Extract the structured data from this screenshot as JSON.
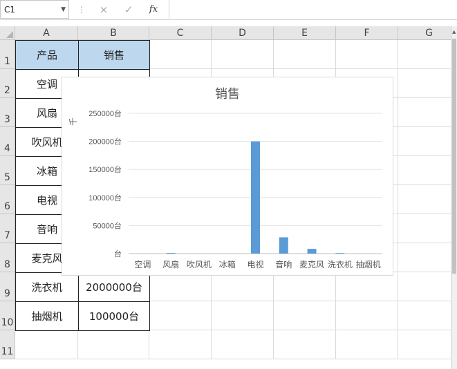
{
  "formula_bar": {
    "name_box": "C1",
    "separator": "⋮",
    "cancel_icon": "×",
    "enter_icon": "✓",
    "fx_label": "fx",
    "formula": ""
  },
  "columns": [
    "A",
    "B",
    "C",
    "D",
    "E",
    "F",
    "G"
  ],
  "rows": [
    "1",
    "2",
    "3",
    "4",
    "5",
    "6",
    "7",
    "8",
    "9",
    "10",
    "11"
  ],
  "table": {
    "header": [
      "产品",
      "销售"
    ],
    "products": [
      "空调",
      "风扇",
      "吹风机",
      "冰箱",
      "电视",
      "音响",
      "麦克风",
      "洗衣机",
      "抽烟机"
    ],
    "visible_sales": {
      "row9": "2000000台",
      "row10": "100000台"
    }
  },
  "chart_data": {
    "type": "bar",
    "title": "销售",
    "ylabel": "千",
    "categories": [
      "空调",
      "风扇",
      "吹风机",
      "冰箱",
      "电视",
      "音响",
      "麦克风",
      "洗衣机",
      "抽烟机"
    ],
    "values": [
      0,
      1200,
      0,
      0,
      200000,
      29000,
      8500,
      1000,
      0
    ],
    "ylim": [
      0,
      250000
    ],
    "yticks": [
      0,
      50000,
      100000,
      150000,
      200000,
      250000
    ],
    "ytick_labels": [
      "台",
      "50000台",
      "100000台",
      "150000台",
      "200000台",
      "250000台"
    ],
    "grid": true,
    "bar_color": "#5b9bd5"
  }
}
